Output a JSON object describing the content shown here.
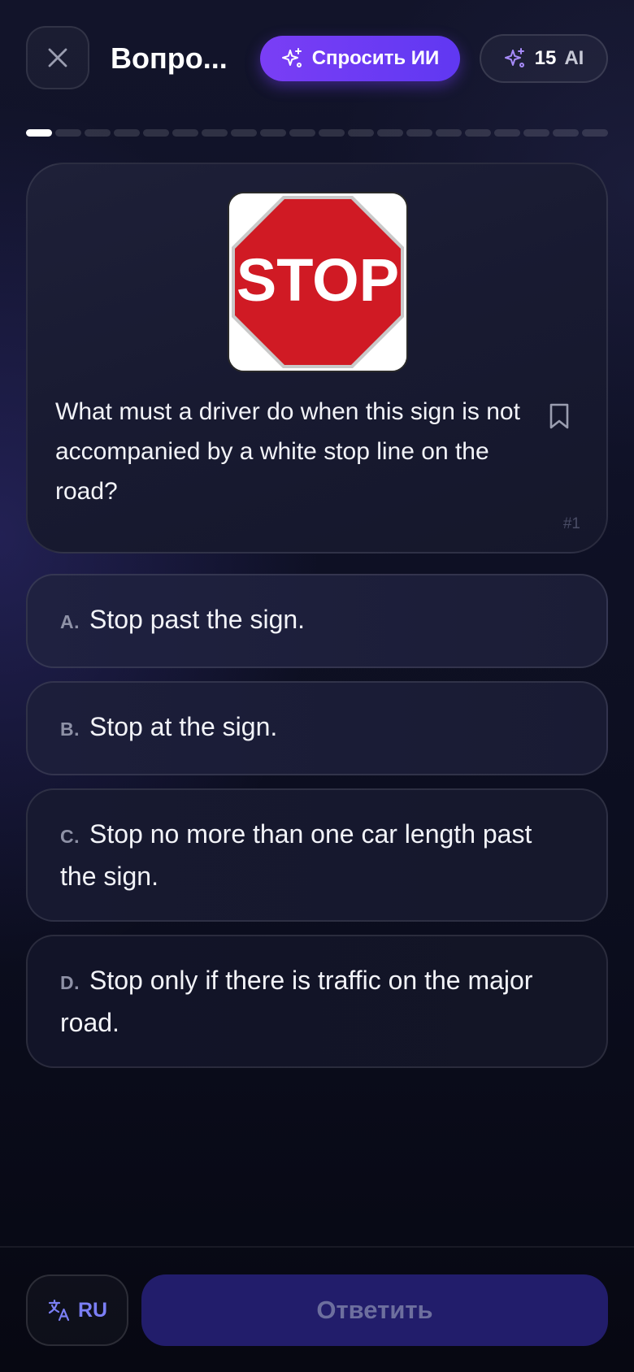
{
  "header": {
    "close_icon": "close-icon",
    "title": "Вопро...",
    "ask_ai": {
      "label": "Спросить ИИ",
      "icon": "sparkles-icon"
    },
    "credits": {
      "count": "15",
      "unit": "AI",
      "icon": "sparkles-icon"
    }
  },
  "progress": {
    "current": 1,
    "total": 20
  },
  "question": {
    "image": "stop-sign",
    "sign_text": "STOP",
    "text": "What must a driver do when this sign is not accompanied by a white stop line on the road?",
    "number": "#1",
    "bookmark_icon": "bookmark-icon"
  },
  "options": [
    {
      "letter": "A.",
      "text": "Stop past the sign."
    },
    {
      "letter": "B.",
      "text": "Stop at the sign."
    },
    {
      "letter": "C.",
      "text": "Stop no more than one car length past the sign."
    },
    {
      "letter": "D.",
      "text": "Stop only if there is traffic on the major road."
    }
  ],
  "footer": {
    "language": {
      "label": "RU",
      "icon": "translate-icon"
    },
    "submit_label": "Ответить"
  },
  "colors": {
    "accent": "#6b3cf4",
    "submit_bg": "#221d6b",
    "language_accent": "#7b7ff5",
    "stop_red": "#d01a24"
  }
}
